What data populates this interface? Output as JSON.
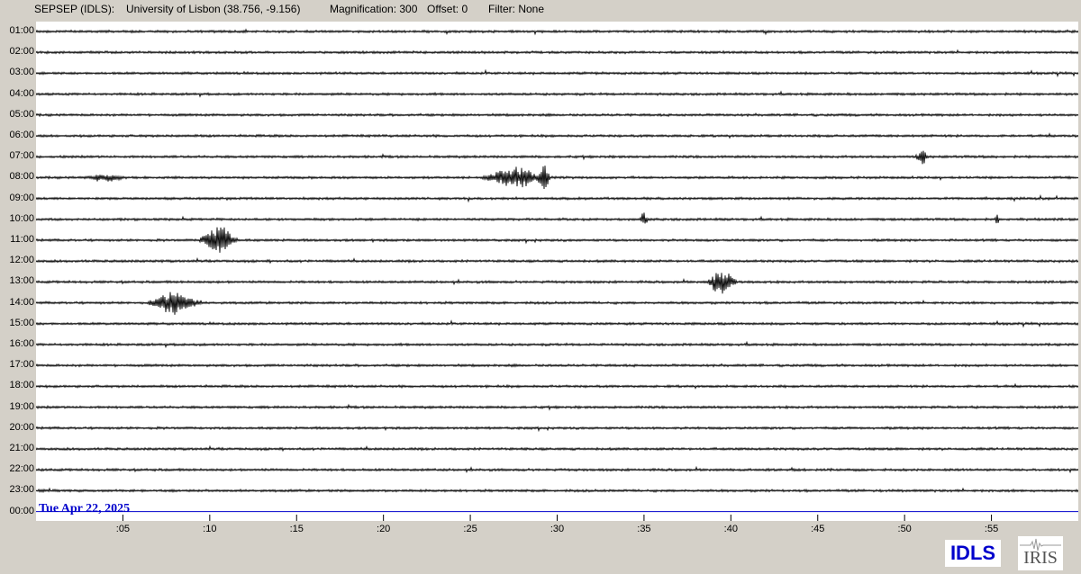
{
  "header": {
    "station": "SEPSEP (IDLS):",
    "location": "University of Lisbon (38.756, -9.156)",
    "magnification": "Magnification: 300",
    "offset": "Offset: 0",
    "filter": "Filter: None"
  },
  "date_label": "Tue Apr 22, 2025",
  "station_logo": "IDLS",
  "iris_logo": "IRIS",
  "colors": {
    "trace": "#000000",
    "current_hour_line": "#0000cc",
    "date_text": "#0000cc",
    "background": "#d4d0c8"
  },
  "chart_data": {
    "type": "line",
    "hour_labels": [
      "01:00",
      "02:00",
      "03:00",
      "04:00",
      "05:00",
      "06:00",
      "07:00",
      "08:00",
      "09:00",
      "10:00",
      "11:00",
      "12:00",
      "13:00",
      "14:00",
      "15:00",
      "16:00",
      "17:00",
      "18:00",
      "19:00",
      "20:00",
      "21:00",
      "22:00",
      "23:00",
      "00:00"
    ],
    "minute_ticks": [
      ":05",
      ":10",
      ":15",
      ":20",
      ":25",
      ":30",
      ":35",
      ":40",
      ":45",
      ":50",
      ":55"
    ],
    "minute_tick_values": [
      5,
      10,
      15,
      20,
      25,
      30,
      35,
      40,
      45,
      50,
      55
    ],
    "xlim": [
      0,
      60
    ],
    "current_hour_index": 23,
    "events": [
      {
        "hour": "07:00",
        "minute": 51.0,
        "duration": 0.6,
        "amplitude": 11
      },
      {
        "hour": "08:00",
        "minute": 4.0,
        "duration": 2.0,
        "amplitude": 6
      },
      {
        "hour": "08:00",
        "minute": 27.5,
        "duration": 3.0,
        "amplitude": 14
      },
      {
        "hour": "08:00",
        "minute": 29.2,
        "duration": 0.6,
        "amplitude": 28
      },
      {
        "hour": "10:00",
        "minute": 35.0,
        "duration": 0.4,
        "amplitude": 9
      },
      {
        "hour": "10:00",
        "minute": 55.3,
        "duration": 0.2,
        "amplitude": 11
      },
      {
        "hour": "11:00",
        "minute": 10.5,
        "duration": 1.8,
        "amplitude": 22
      },
      {
        "hour": "13:00",
        "minute": 39.5,
        "duration": 1.4,
        "amplitude": 18
      },
      {
        "hour": "14:00",
        "minute": 8.0,
        "duration": 2.5,
        "amplitude": 16
      }
    ]
  }
}
